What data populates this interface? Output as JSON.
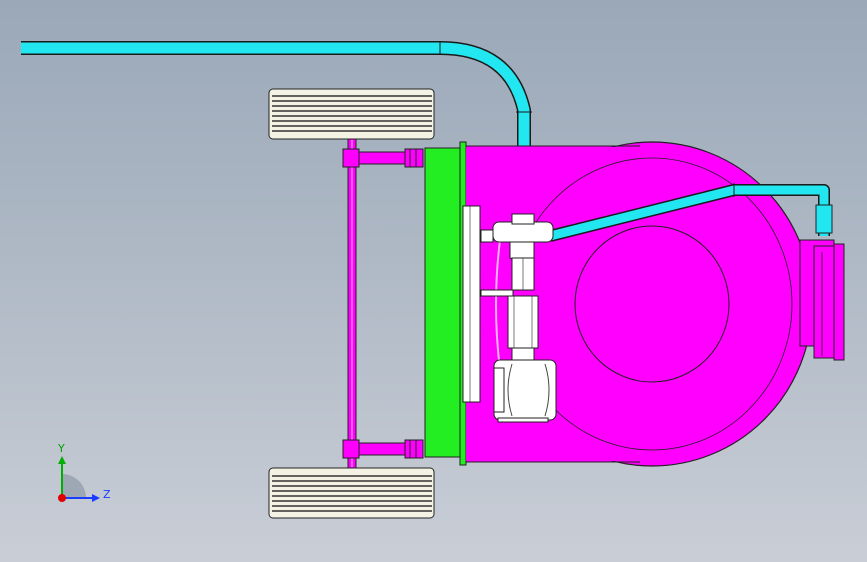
{
  "viewport": {
    "background_top": "#9aa8b8",
    "background_bottom": "#c9ced6"
  },
  "colors": {
    "pipe": "#22e6f0",
    "housing": "#ff00ff",
    "plate": "#22ee22",
    "wheel": "#f4f2e4",
    "outline": "#202020"
  },
  "triad": {
    "y_label": "Y",
    "z_label": "Z",
    "y_color": "#00b000",
    "z_color": "#1a3cff",
    "x_color": "#e00000"
  }
}
